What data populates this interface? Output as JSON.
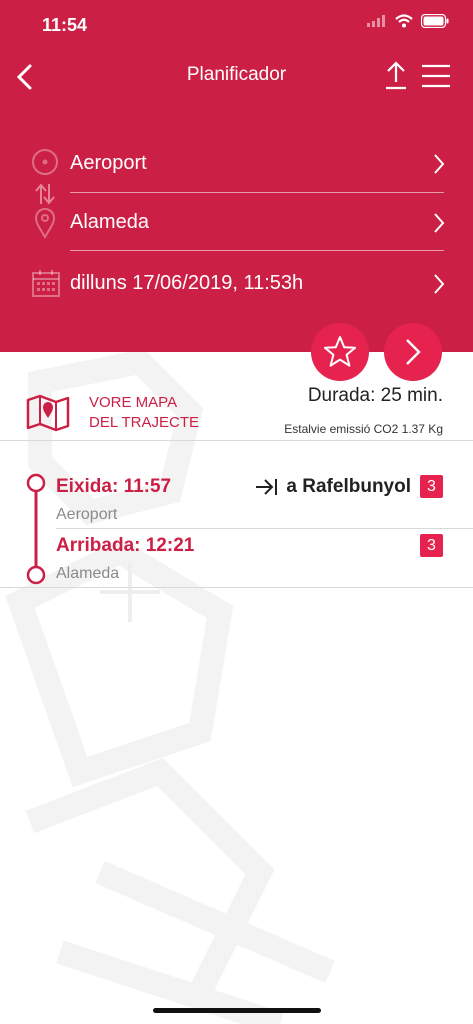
{
  "status_bar": {
    "time": "11:54"
  },
  "nav": {
    "title": "Planificador"
  },
  "planner": {
    "origin": "Aeroport",
    "destination": "Alameda",
    "datetime": "dilluns 17/06/2019, 11:53h"
  },
  "colors": {
    "brand": "#cc1f45",
    "accent": "#e6234e"
  },
  "route": {
    "map_link": "VORE MAPA\nDEL TRAJECTE",
    "duration": "Durada: 25 min.",
    "co2": "Estalvie emissió CO2 1.37 Kg"
  },
  "legs": [
    {
      "label": "Eixida: 11:57",
      "station": "Aeroport",
      "direction": "a Rafelbunyol",
      "line": "3"
    },
    {
      "label": "Arribada: 12:21",
      "station": "Alameda",
      "line": "3"
    }
  ]
}
